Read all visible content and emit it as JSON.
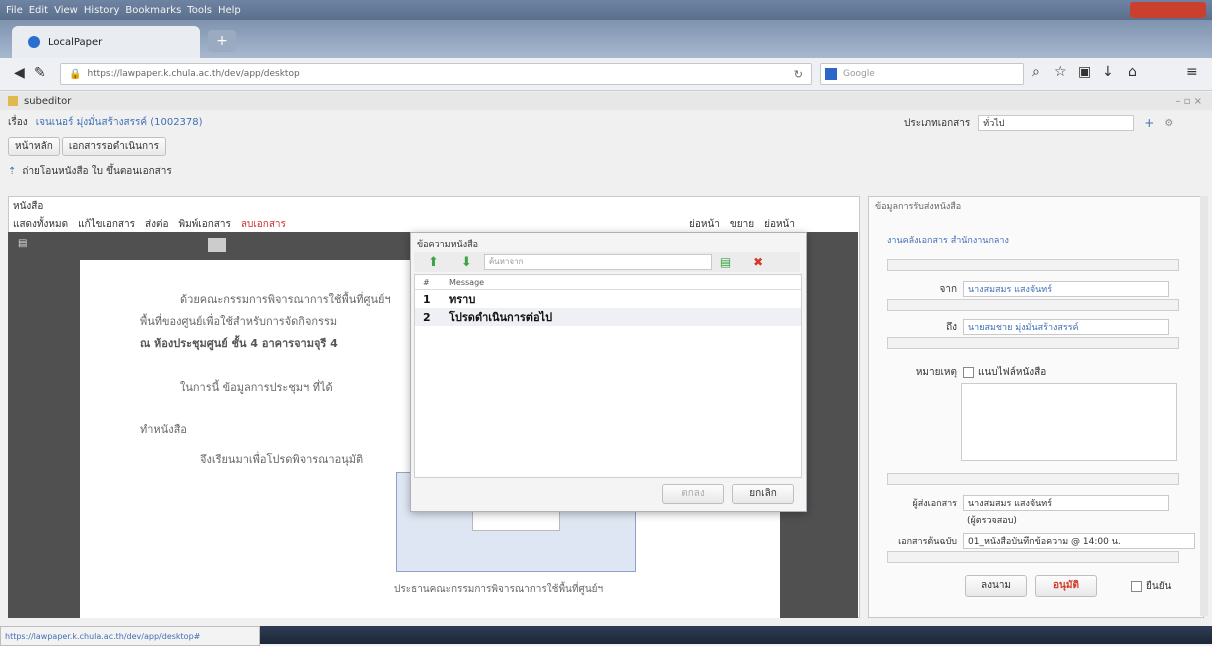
{
  "menu": [
    "File",
    "Edit",
    "View",
    "History",
    "Bookmarks",
    "Tools",
    "Help"
  ],
  "browser": {
    "tab_title": "LocalPaper",
    "new_tab": "+",
    "url": "https://lawpaper.k.chula.ac.th/dev/app/desktop",
    "search_placeholder": "Google",
    "status_url": "https://lawpaper.k.chula.ac.th/dev/app/desktop#"
  },
  "app": {
    "window_title": "subeditor",
    "from_label": "เรื่อง",
    "from_value": "เจนเนอร์ มุ่งมั่นสร้างสรรค์ (1002378)",
    "doc_type_label": "ประเภทเอกสาร",
    "doc_type_value": "ทั่วไป",
    "subtab1": "หน้าหลัก",
    "subtab2": "เอกสารรอดำเนินการ",
    "action_line": "ถ่ายโอนหนังสือ ใบ ขึ้นตอนเอกสาร",
    "left_title": "หนังสือ",
    "toolbar": [
      "แสดงทั้งหมด",
      "แก้ไขเอกสาร",
      "ส่งต่อ",
      "พิมพ์เอกสาร",
      "ลบเอกสาร"
    ],
    "toolbar_right": [
      "ย่อหน้า",
      "ขยาย",
      "ย่อหน้า"
    ],
    "doc_text": [
      "ด้วยคณะกรรมการพิจารณาการใช้พื้นที่ศูนย์ฯ",
      "พื้นที่ของศูนย์เพื่อใช้สำหรับการจัดกิจกรรม",
      "ณ ห้องประชุมศูนย์ ชั้น 4 อาคารจามจุรี 4",
      "ในการนี้ ข้อมูลการประชุมฯ ที่ได้",
      "ทำหนังสือ",
      "จึงเรียนมาเพื่อโปรดพิจารณาอนุมัติ",
      "ประธานคณะกรรมการพิจารณาการใช้พื้นที่ศูนย์ฯ"
    ],
    "right_title": "ข้อมูลการรับส่งหนังสือ",
    "right_head": "งานคลังเอกสาร สำนักงานกลาง",
    "from_field_label": "จาก",
    "from_field_value": "นางสมสมร แสงจันทร์",
    "to_field_label": "ถึง",
    "to_field_value": "นายสมชาย มุ่งมั่นสร้างสรรค์",
    "note_label": "หมายเหตุ",
    "note_check": "แนบไฟล์หนังสือ",
    "sender_label": "ผู้ส่งเอกสาร",
    "sender_value": "นางสมสมร แสงจันทร์",
    "sender_sub": "(ผู้ตรวจสอบ)",
    "doc_label": "เอกสารต้นฉบับ",
    "doc_value": "01_หนังสือบันทึกข้อความ @ 14:00 น.",
    "btn_sign": "ลงนาม",
    "btn_approve": "อนุมัติ",
    "confirm_check": "ยืนยัน"
  },
  "dialog": {
    "title": "ข้อความหนังสือ",
    "search_placeholder": "ค้นหาจาก",
    "col_num": "#",
    "col_msg": "Message",
    "rows": [
      {
        "n": "1",
        "msg": "ทราบ"
      },
      {
        "n": "2",
        "msg": "โปรดดำเนินการต่อไป"
      }
    ],
    "btn_ok": "ตกลง",
    "btn_cancel": "ยกเลิก"
  },
  "colors": {
    "accent": "#3f6fb5",
    "dialog_border": "#aab1bb",
    "delete": "#d23b2a",
    "add": "#3aa545"
  }
}
